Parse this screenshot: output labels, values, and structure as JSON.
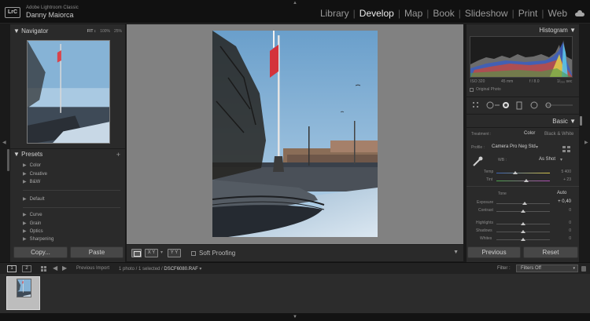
{
  "app": {
    "logo": "LrC",
    "name": "Adobe Lightroom Classic",
    "user": "Danny Maiorca"
  },
  "modules": [
    "Library",
    "Develop",
    "Map",
    "Book",
    "Slideshow",
    "Print",
    "Web"
  ],
  "active_module": "Develop",
  "icons": {
    "cloud": "cloud-sync-icon"
  },
  "navigator": {
    "title": "Navigator",
    "zoom_options": [
      "FIT ↕",
      "100%",
      "25%"
    ]
  },
  "presets": {
    "title": "Presets",
    "groups_a": [
      "Color",
      "Creative",
      "B&W"
    ],
    "groups_b": [
      "Default"
    ],
    "groups_c": [
      "Curve",
      "Grain",
      "Optics",
      "Sharpening"
    ]
  },
  "left_buttons": {
    "copy": "Copy...",
    "paste": "Paste"
  },
  "toolbar": {
    "soft_proofing": "Soft Proofing",
    "xy": "X Y",
    "yy": "Y Y"
  },
  "histogram": {
    "title": "Histogram",
    "iso": "ISO 320",
    "focal": "45 mm",
    "aperture": "f / 8.0",
    "shutter": "1/₂₅₀ sec",
    "original_photo": "Original Photo"
  },
  "basic": {
    "title": "Basic",
    "treatment_label": "Treatment :",
    "treatment_color": "Color",
    "treatment_bw": "Black & White",
    "profile_label": "Profile :",
    "profile_value": "Camera Pro Neg Std",
    "wb_label": "WB :",
    "wb_value": "As Shot",
    "temp_label": "Temp",
    "temp_value": "5 400",
    "tint_label": "Tint",
    "tint_value": "+ 23",
    "tone_label": "Tone",
    "tone_auto": "Auto",
    "exposure_label": "Exposure",
    "exposure_value": "+ 0,40",
    "contrast_label": "Contrast",
    "contrast_value": "0",
    "highlights_label": "Highlights",
    "highlights_value": "0",
    "shadows_label": "Shadows",
    "shadows_value": "0",
    "whites_label": "Whites",
    "whites_value": "0"
  },
  "right_buttons": {
    "previous": "Previous",
    "reset": "Reset"
  },
  "filmstrip_bar": {
    "page1": "1",
    "page2": "2",
    "source": "Previous Import",
    "selection": "1 photo / 1 selected /",
    "filename": "DSCF6080.RAF",
    "filter_label": "Filter :",
    "filter_value": "Filters Off"
  }
}
